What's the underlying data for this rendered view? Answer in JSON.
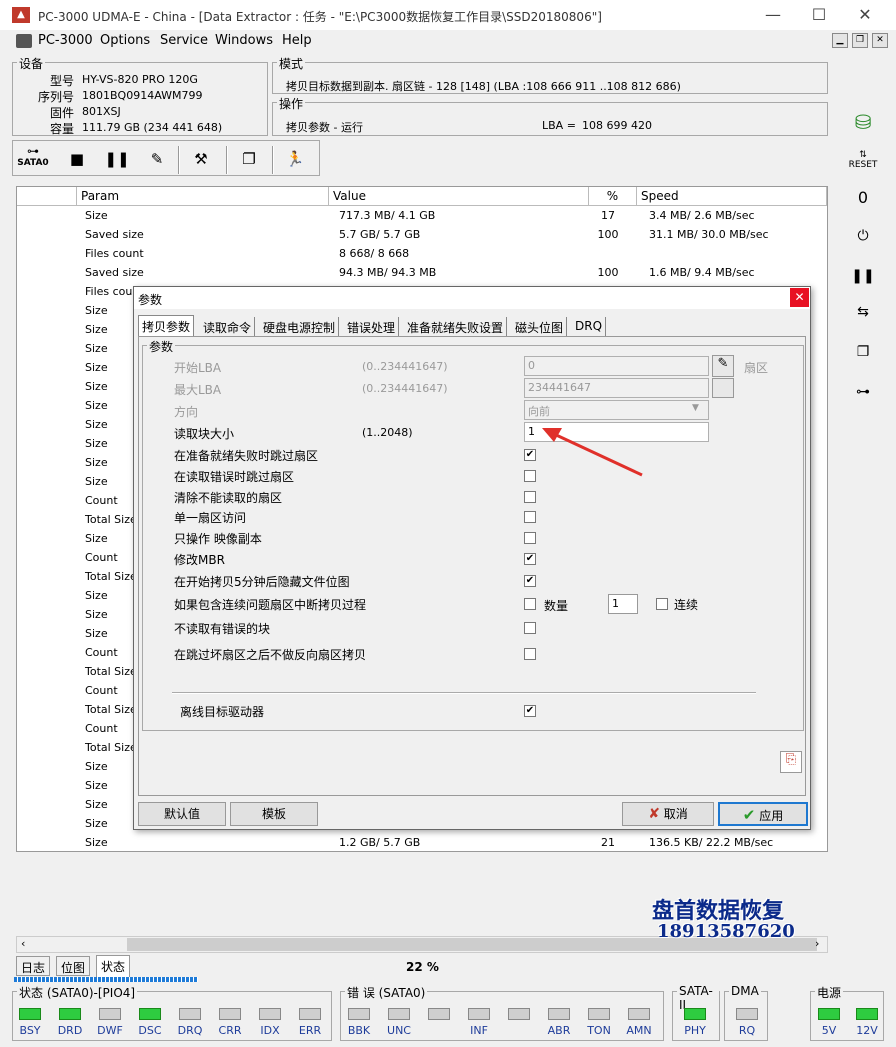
{
  "window": {
    "title": "PC-3000 UDMA-E - China - [Data Extractor : 任务 - \"E:\\PC3000数据恢复工作目录\\SSD20180806\"]"
  },
  "menu": [
    "PC-3000",
    "Options",
    "Service",
    "Windows",
    "Help"
  ],
  "device": {
    "group_title": "设备",
    "model_label": "型号",
    "model": "HY-VS-820 PRO 120G",
    "serial_label": "序列号",
    "serial": "1801BQ0914AWM799",
    "firmware_label": "固件",
    "firmware": "801XSJ",
    "capacity_label": "容量",
    "capacity": "111.79 GB (234 441 648)"
  },
  "mode": {
    "group_title": "模式",
    "text": "拷贝目标数据到副本. 扇区链 - 128 [148] (LBA :108 666 911 ..108 812 686)"
  },
  "operation": {
    "group_title": "操作",
    "text": "拷贝参数 - 运行",
    "lba_label": "LBA =",
    "lba": "108 699 420"
  },
  "toolbar": {
    "sata_label": "SATA0"
  },
  "grid": {
    "headers": [
      "Param",
      "Value",
      "%",
      "Speed"
    ],
    "rows": [
      {
        "param": "Size",
        "value": "717.3 MB/ 4.1 GB",
        "pct": "17",
        "speed": "3.4 MB/ 2.6 MB/sec"
      },
      {
        "param": "Saved size",
        "value": "5.7 GB/ 5.7 GB",
        "pct": "100",
        "speed": "31.1 MB/ 30.0 MB/sec"
      },
      {
        "param": "Files count",
        "value": "8 668/ 8 668",
        "pct": "",
        "speed": ""
      },
      {
        "param": "Saved size",
        "value": "94.3 MB/ 94.3 MB",
        "pct": "100",
        "speed": "1.6 MB/ 9.4 MB/sec"
      },
      {
        "param": "Files count",
        "value": "",
        "pct": "",
        "speed": ""
      },
      {
        "param": "Size",
        "value": "",
        "pct": "",
        "speed": ""
      },
      {
        "param": "Size",
        "value": "",
        "pct": "",
        "speed": ""
      },
      {
        "param": "Size",
        "value": "",
        "pct": "",
        "speed": ""
      },
      {
        "param": "Size",
        "value": "",
        "pct": "",
        "speed": ""
      },
      {
        "param": "Size",
        "value": "",
        "pct": "",
        "speed": ""
      },
      {
        "param": "Size",
        "value": "",
        "pct": "",
        "speed": ""
      },
      {
        "param": "Size",
        "value": "",
        "pct": "",
        "speed": ""
      },
      {
        "param": "Size",
        "value": "",
        "pct": "",
        "speed": ""
      },
      {
        "param": "Size",
        "value": "",
        "pct": "",
        "speed": ""
      },
      {
        "param": "Size",
        "value": "",
        "pct": "",
        "speed": ""
      },
      {
        "param": "Count",
        "value": "",
        "pct": "",
        "speed": ""
      },
      {
        "param": "Total Size",
        "value": "",
        "pct": "",
        "speed": ""
      },
      {
        "param": "Size",
        "value": "",
        "pct": "",
        "speed": ""
      },
      {
        "param": "Count",
        "value": "",
        "pct": "",
        "speed": ""
      },
      {
        "param": "Total Size",
        "value": "",
        "pct": "",
        "speed": ""
      },
      {
        "param": "Size",
        "value": "",
        "pct": "",
        "speed": ""
      },
      {
        "param": "Size",
        "value": "",
        "pct": "",
        "speed": ""
      },
      {
        "param": "Size",
        "value": "",
        "pct": "",
        "speed": ""
      },
      {
        "param": "Count",
        "value": "",
        "pct": "",
        "speed": ""
      },
      {
        "param": "Total Size",
        "value": "",
        "pct": "",
        "speed": ""
      },
      {
        "param": "Count",
        "value": "",
        "pct": "",
        "speed": ""
      },
      {
        "param": "Total Size",
        "value": "",
        "pct": "",
        "speed": ""
      },
      {
        "param": "Count",
        "value": "",
        "pct": "",
        "speed": ""
      },
      {
        "param": "Total Size",
        "value": "",
        "pct": "",
        "speed": ""
      },
      {
        "param": "Size",
        "value": "",
        "pct": "",
        "speed": ""
      },
      {
        "param": "Size",
        "value": "",
        "pct": "",
        "speed": ""
      },
      {
        "param": "Size",
        "value": "",
        "pct": "",
        "speed": ""
      },
      {
        "param": "Size",
        "value": "",
        "pct": "",
        "speed": ""
      },
      {
        "param": "Size",
        "value": "1.2 GB/ 5.7 GB",
        "pct": "21",
        "speed": "136.5 KB/ 22.2 MB/sec"
      }
    ]
  },
  "bottom_tabs": [
    "日志",
    "位图",
    "状态"
  ],
  "progress_text": "22 %",
  "status": {
    "state_title": "状态 (SATA0)-[PIO4]",
    "state_leds": [
      {
        "label": "BSY",
        "on": true
      },
      {
        "label": "DRD",
        "on": true
      },
      {
        "label": "DWF",
        "on": false
      },
      {
        "label": "DSC",
        "on": true
      },
      {
        "label": "DRQ",
        "on": false
      },
      {
        "label": "CRR",
        "on": false
      },
      {
        "label": "IDX",
        "on": false
      },
      {
        "label": "ERR",
        "on": false
      }
    ],
    "error_title": "错 误 (SATA0)",
    "error_leds": [
      {
        "label": "BBK",
        "on": false
      },
      {
        "label": "UNC",
        "on": false
      },
      {
        "label": "",
        "on": false
      },
      {
        "label": "INF",
        "on": false
      },
      {
        "label": "",
        "on": false
      },
      {
        "label": "ABR",
        "on": false
      },
      {
        "label": "TON",
        "on": false
      },
      {
        "label": "AMN",
        "on": false
      }
    ],
    "sata_title": "SATA-II",
    "sata_led": {
      "label": "PHY",
      "on": true
    },
    "dma_title": "DMA",
    "dma_led": {
      "label": "RQ",
      "on": false
    },
    "power_title": "电源",
    "power_leds": [
      {
        "label": "5V",
        "on": true
      },
      {
        "label": "12V",
        "on": true
      }
    ]
  },
  "dialog": {
    "title": "参数",
    "tabs": [
      "拷贝参数",
      "读取命令",
      "硬盘电源控制",
      "错误处理",
      "准备就绪失败设置",
      "磁头位图",
      "DRQ"
    ],
    "group_title": "参数",
    "start_lba_label": "开始LBA",
    "start_lba_range": "(0..234441647)",
    "start_lba": "0",
    "sector_label": "扇区",
    "max_lba_label": "最大LBA",
    "max_lba_range": "(0..234441647)",
    "max_lba": "234441647",
    "direction_label": "方向",
    "direction": "向前",
    "block_size_label": "读取块大小",
    "block_size_range": "(1..2048)",
    "block_size": "1",
    "checks": [
      {
        "label": "在准备就绪失败时跳过扇区",
        "checked": true
      },
      {
        "label": "在读取错误时跳过扇区",
        "checked": false
      },
      {
        "label": "清除不能读取的扇区",
        "checked": false
      },
      {
        "label": "单一扇区访问",
        "checked": false
      },
      {
        "label": "只操作 映像副本",
        "checked": false
      },
      {
        "label": "修改MBR",
        "checked": true
      },
      {
        "label": "在开始拷贝5分钟后隐藏文件位图",
        "checked": true
      },
      {
        "label": "如果包含连续问题扇区中断拷贝过程",
        "checked": false
      },
      {
        "label": "不读取有错误的块",
        "checked": false
      },
      {
        "label": "在跳过坏扇区之后不做反向扇区拷贝",
        "checked": false
      }
    ],
    "count_label": "数量",
    "count_value": "1",
    "continuous_label": "连续",
    "offline_label": "离线目标驱动器",
    "offline_checked": true,
    "default_button": "默认值",
    "template_button": "模板",
    "cancel_button": "取消",
    "apply_button": "应用"
  },
  "watermark": {
    "line1": "盘首数据恢复",
    "line2": "18913587620"
  }
}
